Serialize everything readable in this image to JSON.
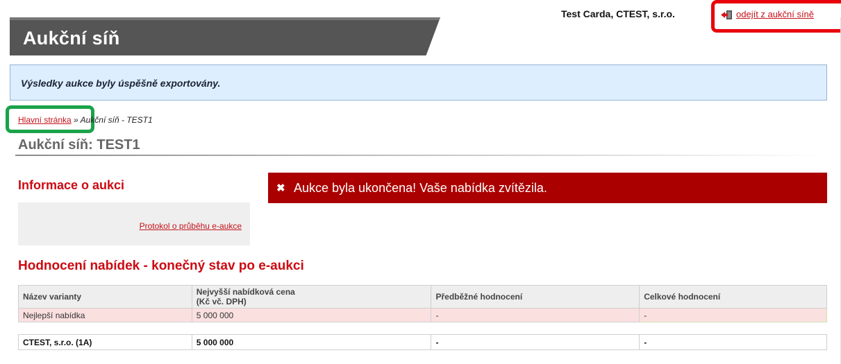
{
  "header": {
    "title": "Aukční síň",
    "user": "Test Carda, CTEST, s.r.o.",
    "logout_label": "odejít z aukční síně",
    "logout_icon": "exit-door-icon"
  },
  "message": {
    "text": "Výsledky aukce byly úspěšně exportovány."
  },
  "breadcrumb": {
    "home_label": "Hlavní stránka",
    "separator": "»",
    "current": "Aukční síň - TEST1"
  },
  "page": {
    "title": "Aukční síň: TEST1"
  },
  "info": {
    "heading": "Informace o aukci",
    "protocol_link": "Protokol o průběhu e-aukce"
  },
  "alert": {
    "icon": "close-icon",
    "text": "Aukce byla ukončena! Vaše nabídka zvítězila."
  },
  "evaluation": {
    "heading": "Hodnocení nabídek - konečný stav po e-aukci",
    "columns": [
      "Název varianty",
      "Nejvyšší nabídková cena",
      "(Kč vč. DPH)",
      "Předběžné hodnocení",
      "Celkové hodnocení"
    ],
    "best_row": [
      "Nejlepší nabídka",
      "5 000 000",
      "-",
      "-"
    ],
    "company_row": [
      "CTEST, s.r.o. (1A)",
      "5 000 000",
      "-",
      "-"
    ]
  },
  "colors": {
    "accent": "#cc0a12",
    "header_dark": "#555555",
    "alert_bg": "#ab0000",
    "message_bg": "#ddeeff",
    "highlight_logout": "#e8000b",
    "highlight_breadcrumb": "#1aa34a"
  }
}
